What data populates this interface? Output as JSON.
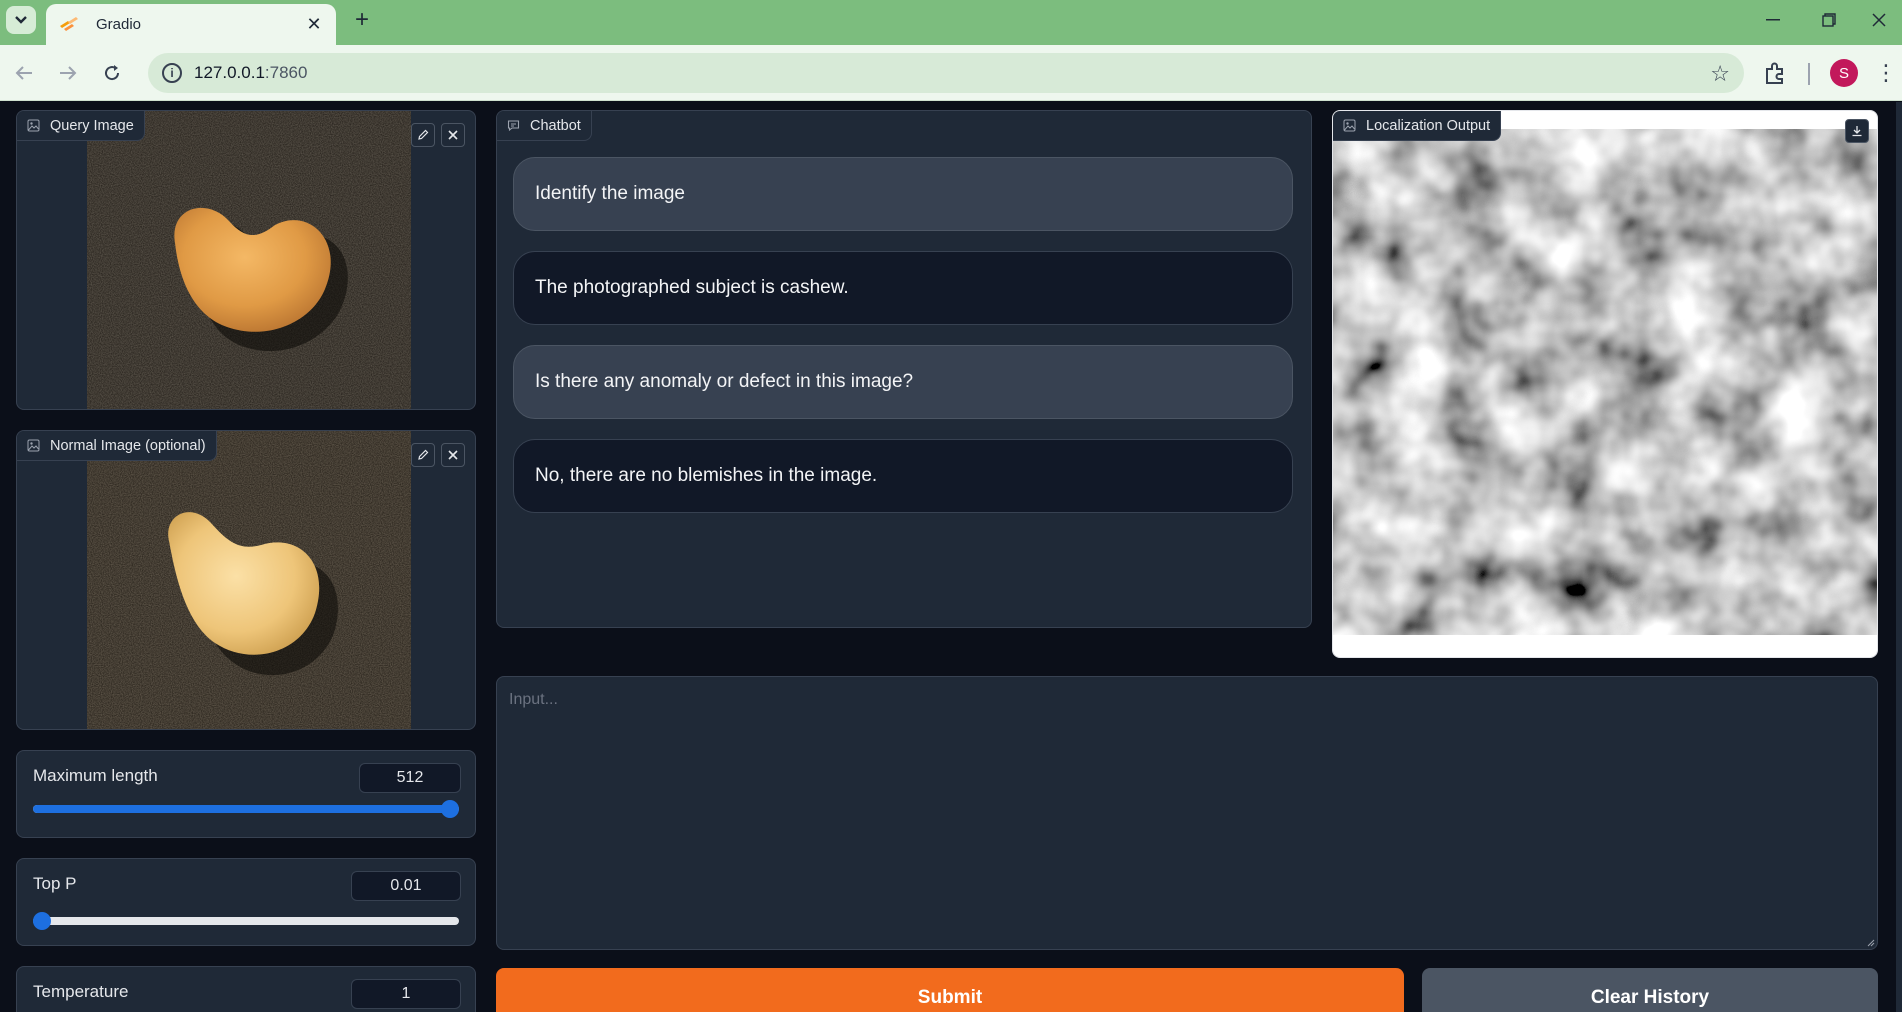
{
  "browser": {
    "tab_title": "Gradio",
    "tab_close": "✕",
    "new_tab": "+",
    "url_host": "127.0.0.1",
    "url_port": ":7860",
    "profile_initial": "S",
    "icons": [
      "tab-search-icon",
      "back-icon",
      "forward-icon",
      "reload-icon",
      "site-info-icon",
      "bookmark-star-icon",
      "extensions-icon",
      "menu-icon",
      "minimize-icon",
      "restore-icon",
      "close-icon"
    ]
  },
  "left": {
    "query_image_label": "Query Image",
    "normal_image_label": "Normal Image (optional)",
    "max_length": {
      "label": "Maximum length",
      "value": "512",
      "fraction": 1.0
    },
    "top_p": {
      "label": "Top P",
      "value": "0.01",
      "fraction": 0.0
    },
    "temperature": {
      "label": "Temperature",
      "value": "1"
    }
  },
  "chatbot": {
    "label": "Chatbot",
    "messages": [
      {
        "role": "user",
        "text": "Identify the image"
      },
      {
        "role": "bot",
        "text": "The photographed subject is cashew."
      },
      {
        "role": "user",
        "text": "Is there any anomaly or defect in this image?"
      },
      {
        "role": "bot",
        "text": "No, there are no blemishes in the image."
      }
    ]
  },
  "localization": {
    "label": "Localization Output"
  },
  "input": {
    "placeholder": "Input..."
  },
  "buttons": {
    "submit": "Submit",
    "clear": "Clear History"
  },
  "colors": {
    "accent_orange": "#f26b1d",
    "slider_blue": "#1d6fe0",
    "chrome_green": "#7cbd7e"
  }
}
